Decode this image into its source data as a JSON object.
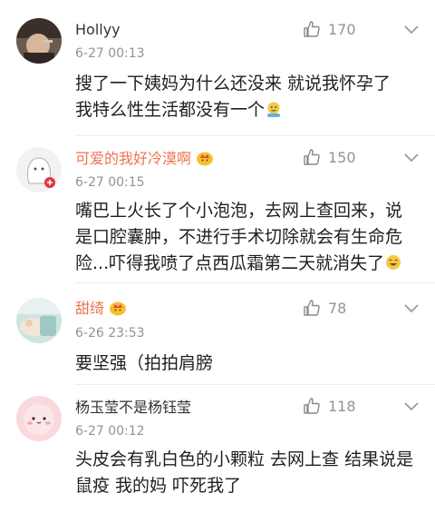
{
  "comments": [
    {
      "username": "Hollyy",
      "time": "6-27 00:13",
      "likes": "170",
      "text_lines": [
        "搜了一下姨妈为什么还没来 就说我怀孕了",
        "我特么性生活都没有一个"
      ],
      "vip": false
    },
    {
      "username": "可爱的我好冷漠啊",
      "time": "6-27 00:15",
      "likes": "150",
      "text_lines": [
        "嘴巴上火长了个小泡泡，去网上查回来，说",
        "是口腔囊肿，不进行手术切除就会有生命危",
        "险...吓得我喷了点西瓜霜第二天就消失了"
      ],
      "vip": true
    },
    {
      "username": "甜绮",
      "time": "6-26 23:53",
      "likes": "78",
      "text_lines": [
        "要坚强（拍拍肩膀"
      ],
      "vip": true
    },
    {
      "username": "杨玉莹不是杨钰莹",
      "time": "6-27 00:12",
      "likes": "118",
      "text_lines": [
        "头皮会有乳白色的小颗粒 去网上查 结果说是",
        "鼠疫 我的妈 吓死我了"
      ],
      "vip": false
    }
  ],
  "icons": {
    "like": "thumbs-up-icon",
    "menu": "chevron-down-icon",
    "vip_badge": "crown-icon"
  },
  "colors": {
    "vip_name": "#eb7350",
    "meta_gray": "#939393",
    "body_text": "#1f1f1f"
  }
}
